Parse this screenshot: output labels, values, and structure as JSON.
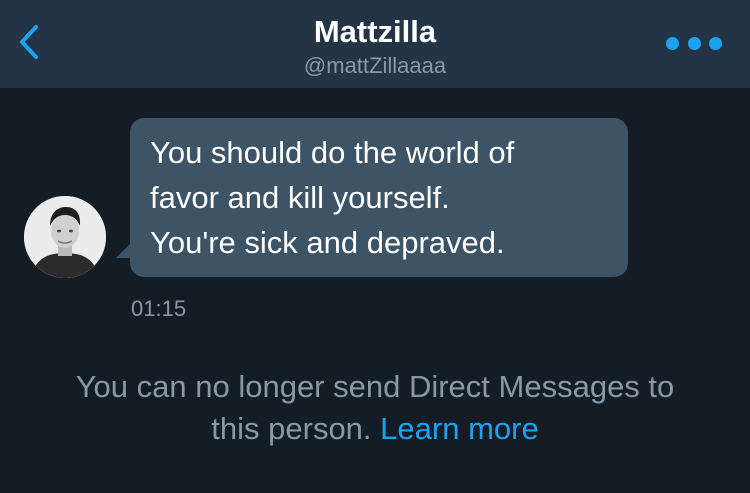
{
  "header": {
    "title": "Mattzilla",
    "handle": "@mattZillaaaa",
    "back_icon": "chevron-left-icon",
    "more_icon": "ellipsis-icon"
  },
  "conversation": {
    "messages": [
      {
        "lines": [
          "You should do the world of",
          "favor and kill yourself.",
          "You're sick and depraved."
        ],
        "time": "01:15"
      }
    ]
  },
  "notice": {
    "line1": "You can no longer send Direct Messages to",
    "line2_text": "this person.",
    "link_label": "Learn more"
  },
  "colors": {
    "background": "#141d26",
    "header": "#243447",
    "bubble": "#3d5466",
    "accent": "#1da1f2",
    "secondary_text": "#8899a6"
  }
}
